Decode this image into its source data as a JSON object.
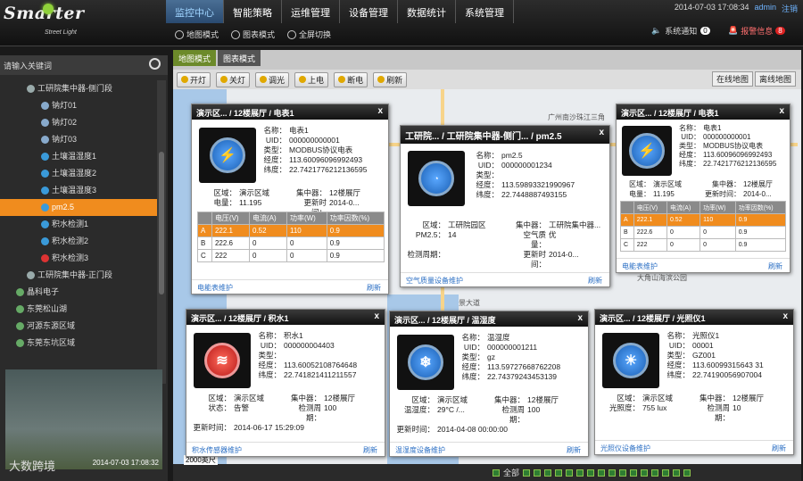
{
  "logo": {
    "title": "Smarter",
    "subtitle": "Street Light"
  },
  "nav": [
    "监控中心",
    "智能策略",
    "运维管理",
    "设备管理",
    "数据统计",
    "系统管理"
  ],
  "subnav": [
    "地图模式",
    "图表模式",
    "全屏切换"
  ],
  "top_right": {
    "datetime": "2014-07-03 17:08:34",
    "user": "admin",
    "logout": "注销"
  },
  "notify": {
    "label": "系统通知",
    "count": "0"
  },
  "alarm": {
    "label": "报警信息",
    "count": "8"
  },
  "search": {
    "placeholder": "请输入关键词"
  },
  "tree": [
    {
      "label": "工研院集中器-侧门段",
      "indent": 30,
      "color": "#9aa"
    },
    {
      "label": "钠灯01",
      "indent": 46,
      "color": "#8ac"
    },
    {
      "label": "钠灯02",
      "indent": 46,
      "color": "#8ac"
    },
    {
      "label": "钠灯03",
      "indent": 46,
      "color": "#8ac"
    },
    {
      "label": "土壤温湿度1",
      "indent": 46,
      "color": "#3a9ad9"
    },
    {
      "label": "土壤温湿度2",
      "indent": 46,
      "color": "#3a9ad9"
    },
    {
      "label": "土壤温湿度3",
      "indent": 46,
      "color": "#3a9ad9"
    },
    {
      "label": "pm2.5",
      "indent": 46,
      "color": "#3a9ad9",
      "sel": true
    },
    {
      "label": "积水检测1",
      "indent": 46,
      "color": "#3a9ad9"
    },
    {
      "label": "积水检测2",
      "indent": 46,
      "color": "#3a9ad9"
    },
    {
      "label": "积水检测3",
      "indent": 46,
      "color": "#d33"
    },
    {
      "label": "工研院集中器-正门段",
      "indent": 30,
      "color": "#9aa"
    },
    {
      "label": "晶科电子",
      "indent": 18,
      "color": "#6a6"
    },
    {
      "label": "东莞松山湖",
      "indent": 18,
      "color": "#6a6"
    },
    {
      "label": "河源东源区域",
      "indent": 18,
      "color": "#6a6"
    },
    {
      "label": "东莞东坑区域",
      "indent": 18,
      "color": "#6a6"
    }
  ],
  "video": {
    "timestamp": "2014-07-03 17:08:32"
  },
  "watermark": "大数跨境",
  "main_tabs": [
    "地图模式",
    "图表模式"
  ],
  "toolbar": [
    "开灯",
    "关灯",
    "调光",
    "上电",
    "断电",
    "刷新"
  ],
  "map_toggle": [
    "在线地图",
    "离线地图"
  ],
  "map_labels": [
    "广州南沙珠江三角",
    "大角山海滨公园",
    "景大道"
  ],
  "scale": "2000英尺",
  "bottom": {
    "label": "全部"
  },
  "cards": {
    "meter1": {
      "title": "演示区... / 12楼展厅 / 电表1",
      "name": "电表1",
      "uid": "000000000001",
      "type": "MODBUS协议电表",
      "lng": "113.60096096992493",
      "lat": "22.7421776212136595",
      "area_k": "区域：",
      "area": "演示区域",
      "conc_k": "集中器：",
      "conc": "12楼展厅",
      "power_k": "电量：",
      "power": "11.195",
      "upd_k": "更新时间：",
      "upd": "2014-0...",
      "table_head": [
        "",
        "电压(V)",
        "电流(A)",
        "功率(W)",
        "功率因数(%)"
      ],
      "rows": [
        [
          "A",
          "222.1",
          "0.52",
          "110",
          "0.9"
        ],
        [
          "B",
          "222.6",
          "0",
          "0",
          "0.9"
        ],
        [
          "C",
          "222",
          "0",
          "0",
          "0.9"
        ]
      ],
      "foot": "电能表维护",
      "refresh": "刷新"
    },
    "pm25": {
      "title": "工研院... / 工研院集中器-侧门... / pm2.5",
      "name": "pm2.5",
      "uid": "000000001234",
      "type": "",
      "lng": "113.59893321990967",
      "lat": "22.7448887493155",
      "area_k": "区域：",
      "area": "工研院园区",
      "conc_k": "集中器：",
      "conc": "工研院集中器...",
      "pm_k": "PM2.5：",
      "pm": "14",
      "aq_k": "空气质量：",
      "aq": "优",
      "cycle_k": "检测周期：",
      "cycle": "",
      "upd_k": "更新时间：",
      "upd": "2014-0...",
      "foot": "空气质量设备维护",
      "refresh": "刷新"
    },
    "meter2": {
      "title": "演示区... / 12楼展厅 / 电表1",
      "name": "电表1",
      "uid": "000000000001",
      "type": "MODBUS协议电表",
      "lng": "113.60096096992493",
      "lat": "22.7421776212136595",
      "area": "演示区域",
      "conc": "12楼展厅",
      "power": "11.195",
      "upd": "2014-0...",
      "table_head": [
        "",
        "电压(V)",
        "电流(A)",
        "功率(W)",
        "功率因数(%)"
      ],
      "rows": [
        [
          "A",
          "222.1",
          "0.52",
          "110",
          "0.9"
        ],
        [
          "B",
          "222.6",
          "0",
          "0",
          "0.9"
        ],
        [
          "C",
          "222",
          "0",
          "0",
          "0.9"
        ]
      ],
      "foot": "电能表维护",
      "refresh": "刷新"
    },
    "water": {
      "title": "演示区... / 12楼展厅 / 积水1",
      "name": "积水1",
      "uid": "000000004403",
      "type": "",
      "lng": "113.60052108764648",
      "lat": "22.741821411211557",
      "area": "演示区域",
      "conc": "12楼展厅",
      "state_k": "状态：",
      "state": "告警",
      "cycle_k": "检测周期：",
      "cycle": "100",
      "upd": "2014-06-17 15:29:09",
      "foot": "积水传感器维护",
      "refresh": "刷新"
    },
    "temp": {
      "title": "演示区... / 12楼展厅 / 温湿度",
      "name": "温湿度",
      "uid": "000000001211",
      "type": "gz",
      "lng": "113.59727668762208",
      "lat": "22.74379243453139",
      "area": "演示区域",
      "conc": "12楼展厅",
      "t_k": "温湿度：",
      "t": "29°C /...",
      "cycle": "100",
      "upd": "2014-04-08 00:00:00",
      "foot": "温湿度设备维护",
      "refresh": "刷新"
    },
    "light": {
      "title": "演示区... / 12楼展厅 / 光照仪1",
      "name": "光照仪1",
      "uid": "00001",
      "type": "GZ001",
      "lng": "113.60099315643 31",
      "lat": "22.74190056907004",
      "area": "演示区域",
      "conc": "12楼展厅",
      "lux_k": "光照度：",
      "lux": "755 lux",
      "cycle": "10",
      "foot": "光照仪设备维护",
      "refresh": "刷新"
    }
  },
  "labels": {
    "name": "名称：",
    "uid": "UID：",
    "type": "类型：",
    "lng": "经度：",
    "lat": "纬度：",
    "upd": "更新时间：",
    "cycle": "检测周期：",
    "area": "区域：",
    "conc": "集中器："
  },
  "colors": {
    "accent": "#f08c1e",
    "nav_active": "#9fd4ff"
  }
}
